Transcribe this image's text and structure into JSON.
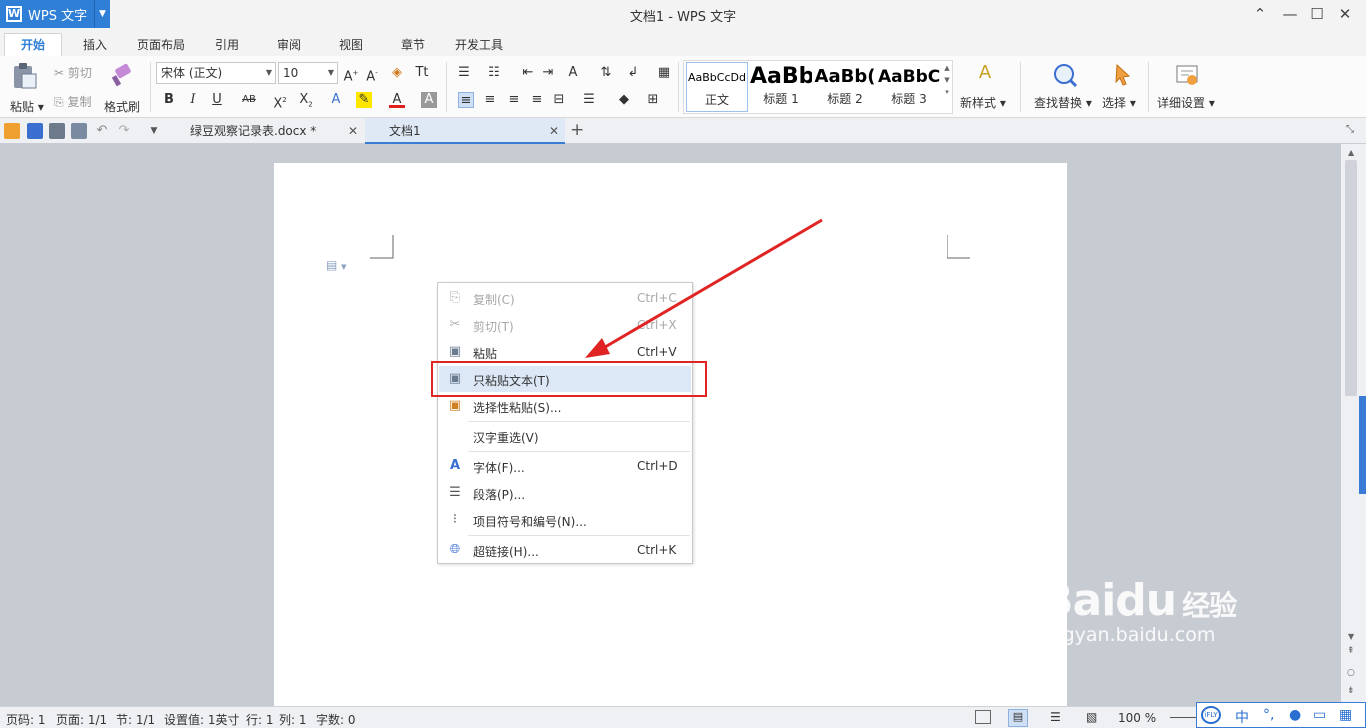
{
  "app": {
    "name": "WPS 文字",
    "window_title": "文档1 - WPS 文字"
  },
  "ribbon_tabs": [
    "开始",
    "插入",
    "页面布局",
    "引用",
    "审阅",
    "视图",
    "章节",
    "开发工具"
  ],
  "ribbon": {
    "paste": "粘贴",
    "cut": "剪切",
    "copy": "复制",
    "format_painter": "格式刷",
    "font_name": "宋体 (正文)",
    "font_size": "10",
    "styles": [
      {
        "preview": "AaBbCcDd",
        "label": "正文"
      },
      {
        "preview": "AaBb",
        "label": "标题 1"
      },
      {
        "preview": "AaBb(",
        "label": "标题 2"
      },
      {
        "preview": "AaBbC",
        "label": "标题 3"
      }
    ],
    "new_style": "新样式",
    "find_replace": "查找替换",
    "select": "选择",
    "detail_settings": "详细设置"
  },
  "doc_tabs": [
    {
      "title": "绿豆观察记录表.docx *"
    },
    {
      "title": "文档1"
    }
  ],
  "context_menu": {
    "items": [
      {
        "label": "复制(C)",
        "shortcut": "Ctrl+C",
        "icon": "copy-icon"
      },
      {
        "label": "剪切(T)",
        "shortcut": "Ctrl+X",
        "icon": "scissors-icon"
      },
      {
        "label": "粘贴",
        "shortcut": "Ctrl+V",
        "icon": "paste-icon"
      },
      {
        "label": "只粘贴文本(T)",
        "shortcut": "",
        "icon": "paste-text-icon"
      },
      {
        "label": "选择性粘贴(S)...",
        "shortcut": "",
        "icon": "paste-special-icon"
      },
      {
        "label": "汉字重选(V)",
        "shortcut": "",
        "icon": ""
      },
      {
        "label": "字体(F)...",
        "shortcut": "Ctrl+D",
        "icon": "font-icon"
      },
      {
        "label": "段落(P)...",
        "shortcut": "",
        "icon": "paragraph-icon"
      },
      {
        "label": "项目符号和编号(N)...",
        "shortcut": "",
        "icon": "list-icon"
      },
      {
        "label": "超链接(H)...",
        "shortcut": "Ctrl+K",
        "icon": "hyperlink-icon"
      }
    ]
  },
  "status_bar": {
    "page_code": "页码: 1",
    "pages": "页面: 1/1",
    "section": "节: 1/1",
    "setting": "设置值: 1英寸",
    "row": "行: 1",
    "col": "列: 1",
    "words": "字数: 0",
    "zoom": "100 %"
  },
  "watermark": {
    "brand": "Baidu",
    "sub": "经验",
    "url": "jingyan.baidu.com"
  },
  "ime": {
    "logo": "iFLY",
    "mode": "中"
  },
  "colors": {
    "accent": "#2f7fd6",
    "highlight": "#e02424",
    "menu_hover": "#dde8f6"
  }
}
